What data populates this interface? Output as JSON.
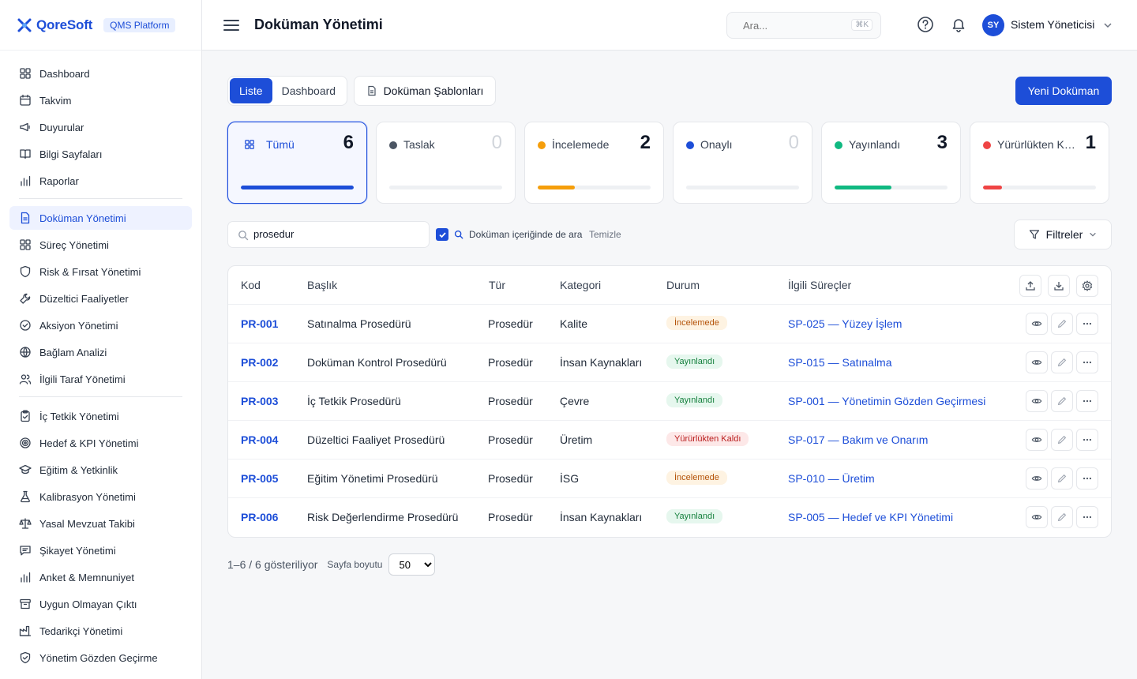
{
  "brand": {
    "name": "QoreSoft",
    "badge": "QMS Platform"
  },
  "header": {
    "title": "Doküman Yönetimi",
    "search_placeholder": "Ara...",
    "search_shortcut": "⌘K",
    "user_initials": "SY",
    "user_name": "Sistem Yöneticisi"
  },
  "sidebar": {
    "group1": [
      {
        "label": "Dashboard",
        "icon": "grid-icon"
      },
      {
        "label": "Takvim",
        "icon": "calendar-icon"
      },
      {
        "label": "Duyurular",
        "icon": "megaphone-icon"
      },
      {
        "label": "Bilgi Sayfaları",
        "icon": "book-icon"
      },
      {
        "label": "Raporlar",
        "icon": "bar-chart-icon"
      }
    ],
    "group2": [
      {
        "label": "Doküman Yönetimi",
        "icon": "document-icon",
        "active": true
      },
      {
        "label": "Süreç Yönetimi",
        "icon": "grid-icon"
      },
      {
        "label": "Risk & Fırsat Yönetimi",
        "icon": "shield-icon"
      },
      {
        "label": "Düzeltici Faaliyetler",
        "icon": "wrench-icon"
      },
      {
        "label": "Aksiyon Yönetimi",
        "icon": "check-circle-icon"
      },
      {
        "label": "Bağlam Analizi",
        "icon": "globe-icon"
      },
      {
        "label": "İlgili Taraf Yönetimi",
        "icon": "users-icon"
      }
    ],
    "group3": [
      {
        "label": "İç Tetkik Yönetimi",
        "icon": "clipboard-icon"
      },
      {
        "label": "Hedef & KPI Yönetimi",
        "icon": "target-icon"
      },
      {
        "label": "Eğitim & Yetkinlik",
        "icon": "graduation-cap-icon"
      },
      {
        "label": "Kalibrasyon Yönetimi",
        "icon": "flask-icon"
      },
      {
        "label": "Yasal Mevzuat Takibi",
        "icon": "scale-icon"
      },
      {
        "label": "Şikayet Yönetimi",
        "icon": "message-icon"
      },
      {
        "label": "Anket & Memnuniyet",
        "icon": "bar-chart-icon"
      },
      {
        "label": "Uygun Olmayan Çıktı",
        "icon": "archive-icon"
      },
      {
        "label": "Tedarikçi Yönetimi",
        "icon": "factory-icon"
      },
      {
        "label": "Yönetim Gözden Geçirme",
        "icon": "shield-check-icon"
      }
    ]
  },
  "toolbar": {
    "tab_list": "Liste",
    "tab_dashboard": "Dashboard",
    "templates": "Doküman Şablonları",
    "new_document": "Yeni Doküman"
  },
  "status_cards": [
    {
      "label": "Tümü",
      "count": "6",
      "color": "#1d4ed8",
      "fill": 1.0
    },
    {
      "label": "Taslak",
      "count": "0",
      "color": "#4b5563",
      "fill": 0
    },
    {
      "label": "İncelemede",
      "count": "2",
      "color": "#f59e0b",
      "fill": 0.33
    },
    {
      "label": "Onaylı",
      "count": "0",
      "color": "#1d4ed8",
      "fill": 0
    },
    {
      "label": "Yayınlandı",
      "count": "3",
      "color": "#10b981",
      "fill": 0.5
    },
    {
      "label": "Yürürlükten Kaldırıldı",
      "count": "1",
      "color": "#ef4444",
      "fill": 0.17
    }
  ],
  "search": {
    "value": "prosedur",
    "content_search_label": "Doküman içeriğinde de ara",
    "clear": "Temizle",
    "filters": "Filtreler"
  },
  "table": {
    "headers": {
      "code": "Kod",
      "title": "Başlık",
      "type": "Tür",
      "category": "Kategori",
      "status": "Durum",
      "processes": "İlgili Süreçler"
    },
    "rows": [
      {
        "code": "PR-001",
        "title": "Satınalma Prosedürü",
        "type": "Prosedür",
        "category": "Kalite",
        "status": "İncelemede",
        "status_kind": "review",
        "process": "SP-025 — Yüzey İşlem"
      },
      {
        "code": "PR-002",
        "title": "Doküman Kontrol Prosedürü",
        "type": "Prosedür",
        "category": "İnsan Kaynakları",
        "status": "Yayınlandı",
        "status_kind": "published",
        "process": "SP-015 — Satınalma"
      },
      {
        "code": "PR-003",
        "title": "İç Tetkik Prosedürü",
        "type": "Prosedür",
        "category": "Çevre",
        "status": "Yayınlandı",
        "status_kind": "published",
        "process": "SP-001 — Yönetimin Gözden Geçirmesi"
      },
      {
        "code": "PR-004",
        "title": "Düzeltici Faaliyet Prosedürü",
        "type": "Prosedür",
        "category": "Üretim",
        "status": "Yürürlükten Kaldı",
        "status_kind": "revoked",
        "process": "SP-017 — Bakım ve Onarım"
      },
      {
        "code": "PR-005",
        "title": "Eğitim Yönetimi Prosedürü",
        "type": "Prosedür",
        "category": "İSG",
        "status": "İncelemede",
        "status_kind": "review",
        "process": "SP-010 — Üretim"
      },
      {
        "code": "PR-006",
        "title": "Risk Değerlendirme Prosedürü",
        "type": "Prosedür",
        "category": "İnsan Kaynakları",
        "status": "Yayınlandı",
        "status_kind": "published",
        "process": "SP-005 — Hedef ve KPI Yönetimi"
      }
    ]
  },
  "footer": {
    "showing": "1–6 / 6 gösteriliyor",
    "page_size_label": "Sayfa boyutu",
    "page_size": "50"
  }
}
